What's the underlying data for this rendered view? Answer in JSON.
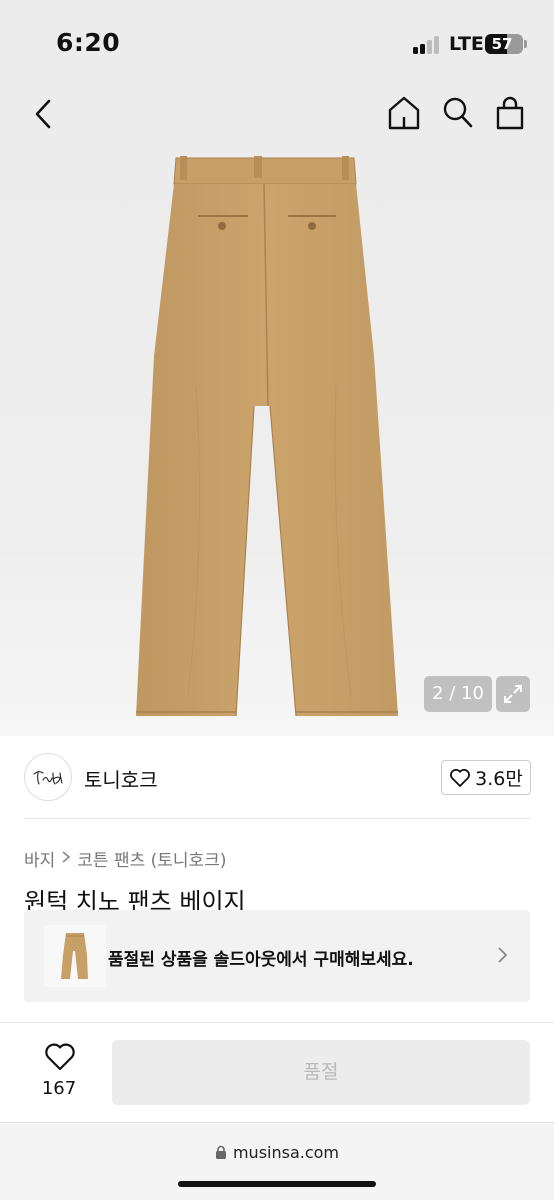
{
  "status_bar": {
    "time": "6:20",
    "network": "LTE",
    "battery": "57",
    "battery_level": 0.57,
    "signal_bars_active": 2,
    "signal_bars_total": 4
  },
  "nav": {
    "icons": [
      "back-chevron-icon",
      "home-icon",
      "search-icon",
      "shopping-bag-icon"
    ]
  },
  "gallery": {
    "counter": "2 / 10",
    "image_subject": "beige one-tuck chino pants, back view",
    "expand_icon": "expand-arrows-icon"
  },
  "brand": {
    "name": "토니호크",
    "like_count": "3.6만",
    "like_icon": "heart-outline-icon"
  },
  "breadcrumb": {
    "category": "바지",
    "subcategory": "코튼 팬츠 (토니호크)"
  },
  "product": {
    "title": "원턱 치노 팬츠 베이지"
  },
  "banner": {
    "text": "품절된 상품을 솔드아웃에서 구매해보세요."
  },
  "action_bar": {
    "wish_count": "167",
    "soldout_label": "품절"
  },
  "browser": {
    "url": "musinsa.com"
  },
  "colors": {
    "pants_beige": "#c8a26d",
    "pants_shadow": "#b38f5c",
    "disabled_button": "#ececec",
    "disabled_text": "#b9b9b9"
  }
}
